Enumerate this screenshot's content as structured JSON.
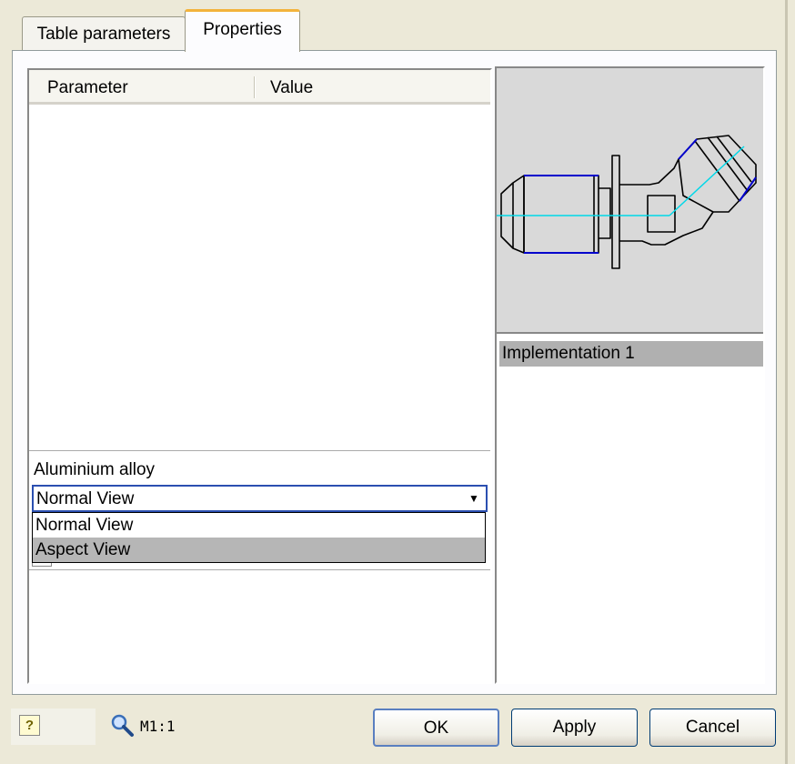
{
  "tabs": [
    {
      "label": "Table parameters",
      "active": false
    },
    {
      "label": "Properties",
      "active": true
    }
  ],
  "grid": {
    "columns": [
      "Parameter",
      "Value"
    ],
    "rows": []
  },
  "material": {
    "label": "Aluminium alloy"
  },
  "view_select": {
    "value": "Normal View",
    "options": [
      "Normal View",
      "Aspect View"
    ],
    "highlighted": "Aspect View"
  },
  "implementations": [
    "Implementation 1"
  ],
  "footer": {
    "help_icon": "help-icon",
    "zoom_label": "M1:1",
    "ok_label": "OK",
    "apply_label": "Apply",
    "cancel_label": "Cancel"
  },
  "colors": {
    "active_tab_accent": "#f3b33c",
    "combo_border": "#2b4fb0",
    "preview_bg": "#d9d9d9",
    "drawing_outline": "#000000",
    "drawing_blue": "#0000cc",
    "drawing_axis": "#00d8e8"
  }
}
